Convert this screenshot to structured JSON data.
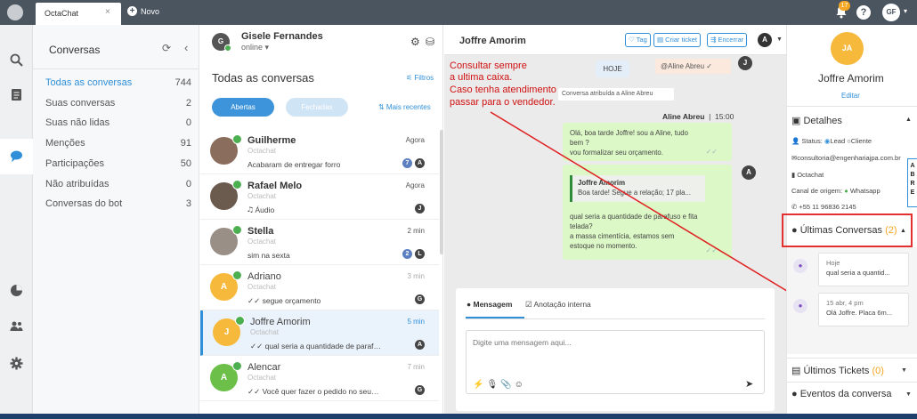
{
  "app": {
    "tab_title": "OctaChat",
    "tab_close": "×",
    "new_tab": "Novo"
  },
  "topbar": {
    "notification_count": "17",
    "help": "?",
    "user_initials": "GF",
    "user_caret": "▾"
  },
  "sidebar": {
    "title": "Conversas",
    "refresh": "⟳",
    "back": "‹",
    "items": [
      {
        "label": "Todas as conversas",
        "count": "744"
      },
      {
        "label": "Suas conversas",
        "count": "2"
      },
      {
        "label": "Suas não lidas",
        "count": "0"
      },
      {
        "label": "Menções",
        "count": "91"
      },
      {
        "label": "Participações",
        "count": "50"
      },
      {
        "label": "Não atribuídas",
        "count": "0"
      },
      {
        "label": "Conversas do bot",
        "count": "3"
      }
    ]
  },
  "agent": {
    "initials": "G",
    "name": "Gisele Fernandes",
    "status": "online ▾"
  },
  "list": {
    "title": "Todas as conversas",
    "filters": "⚟ Filtros",
    "open_label": "Abertas",
    "closed_label": "Fechadas",
    "sort_label": "⇅ Mais recentes",
    "conversations": [
      {
        "name": "Guilherme",
        "source": "Octachat",
        "message": "Acabaram de entregar forro",
        "time": "Agora",
        "badge": "7",
        "agent": "A",
        "avatar_color": "#8a6d5c"
      },
      {
        "name": "Rafael Melo",
        "source": "Octachat",
        "message": "🎝 Áudio",
        "time": "Agora",
        "badge": "",
        "agent": "J",
        "avatar_color": "#6b5a4e"
      },
      {
        "name": "Stella",
        "source": "Octachat",
        "message": "sim na sexta",
        "time": "2 min",
        "badge": "2",
        "agent": "L",
        "avatar_color": "#9a8f86"
      },
      {
        "name": "Adriano",
        "source": "Octachat",
        "message": "✓✓ segue orçamento",
        "time": "3 min",
        "badge": "",
        "agent": "G",
        "initial": "A",
        "avatar_color": "#f6b93b"
      },
      {
        "name": "Joffre Amorim",
        "source": "Octachat",
        "message": "✓✓ qual seria a quantidade de paraf…",
        "time": "5 min",
        "badge": "",
        "agent": "A",
        "initial": "J",
        "avatar_color": "#f6b93b"
      },
      {
        "name": "Alencar",
        "source": "Octachat",
        "message": "✓✓ Você quer fazer o pedido no seu…",
        "time": "7 min",
        "badge": "",
        "agent": "G",
        "initial": "A",
        "avatar_color": "#6cc04a"
      }
    ]
  },
  "chat": {
    "contact_name": "Joffre Amorim",
    "tag_btn": "♡ Tag",
    "ticket_btn": "▤ Criar ticket",
    "close_btn": "⇶ Encerrar",
    "agent_initial": "A",
    "note_lines": [
      "Consultar sempre",
      "a ultima caixa.",
      "Caso tenha atendimento",
      "passar para o vendedor."
    ],
    "today": "HOJE",
    "mention": "@Aline Abreu  ✓",
    "mention_agent": "J",
    "assigned": "Conversa atribuída a Aline Abreu",
    "sender": "Aline Abreu",
    "sender_time": "15:00",
    "bubble1_lines": [
      "Olá, boa tarde Joffre! sou a Aline, tudo",
      "bem ?",
      "vou formalizar seu orçamento."
    ],
    "quote_name": "Joffre Amorim",
    "quote_text": "Boa tarde! Segue a relação; 17 pla...",
    "bubble2_lines": [
      "qual seria a quantidade de parafuso e fita",
      "telada?",
      "a massa cimentícia, estamos sem",
      "estoque no momento."
    ],
    "tab_message": "Mensagem",
    "tab_note": "☑ Anotação interna",
    "input_placeholder": "Digite uma mensagem aqui...",
    "tools": "⚡🎙📎☺",
    "send": "➤"
  },
  "contact": {
    "initials": "JA",
    "name": "Joffre Amorim",
    "edit": "Editar",
    "details_title": "Detalhes",
    "status_label": "Status:",
    "status_lead": "Lead",
    "status_client": "Cliente",
    "email": "consultoria@engenhariajpa.com.br",
    "company": "Octachat",
    "origin_label": "Canal de origem:",
    "origin_value": "Whatsapp",
    "phone": "+55 11 96836 2145",
    "abre": "ABRE",
    "last_conv_title": "Últimas Conversas",
    "last_conv_count": "(2)",
    "last_convs": [
      {
        "date": "Hoje",
        "text": "qual seria a quantid..."
      },
      {
        "date": "15 abr, 4 pm",
        "text": "Olá Joffre. Placa 6m..."
      }
    ],
    "tickets_title": "Últimos Tickets",
    "tickets_count": "(0)",
    "events_title": "Eventos da conversa"
  }
}
